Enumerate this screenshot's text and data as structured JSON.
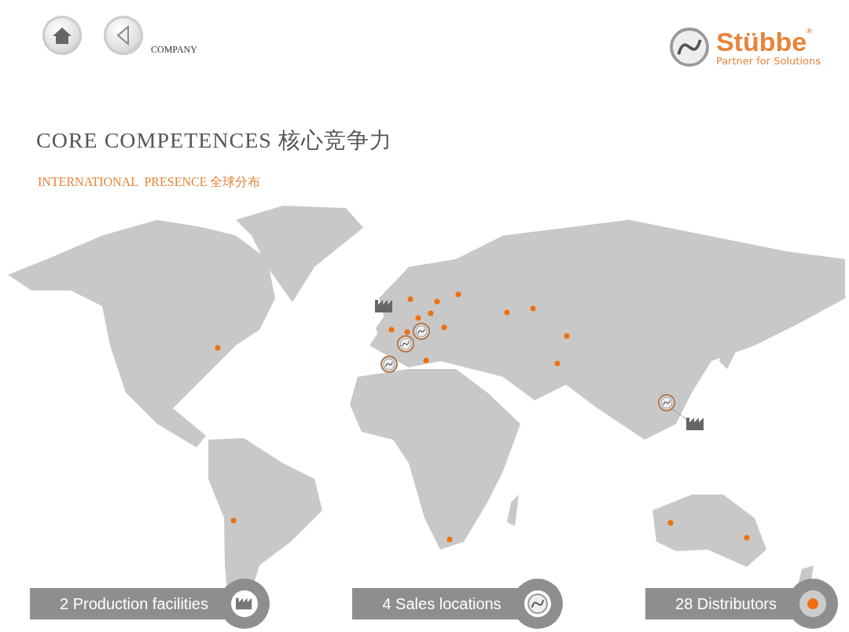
{
  "header": {
    "breadcrumb": "COMPANY"
  },
  "logo": {
    "name": "Stübbe",
    "registered": "®",
    "tagline": "Partner for Solutions"
  },
  "title": "CORE COMPETENCES 核心竞争力",
  "subtitle": "INTERNATIONAL  PRESENCE 全球分布",
  "legend": [
    {
      "label": "2 Production facilities",
      "kind": "factory"
    },
    {
      "label": "4 Sales locations",
      "kind": "sales"
    },
    {
      "label": "28 Distributors",
      "kind": "distributor"
    }
  ]
}
